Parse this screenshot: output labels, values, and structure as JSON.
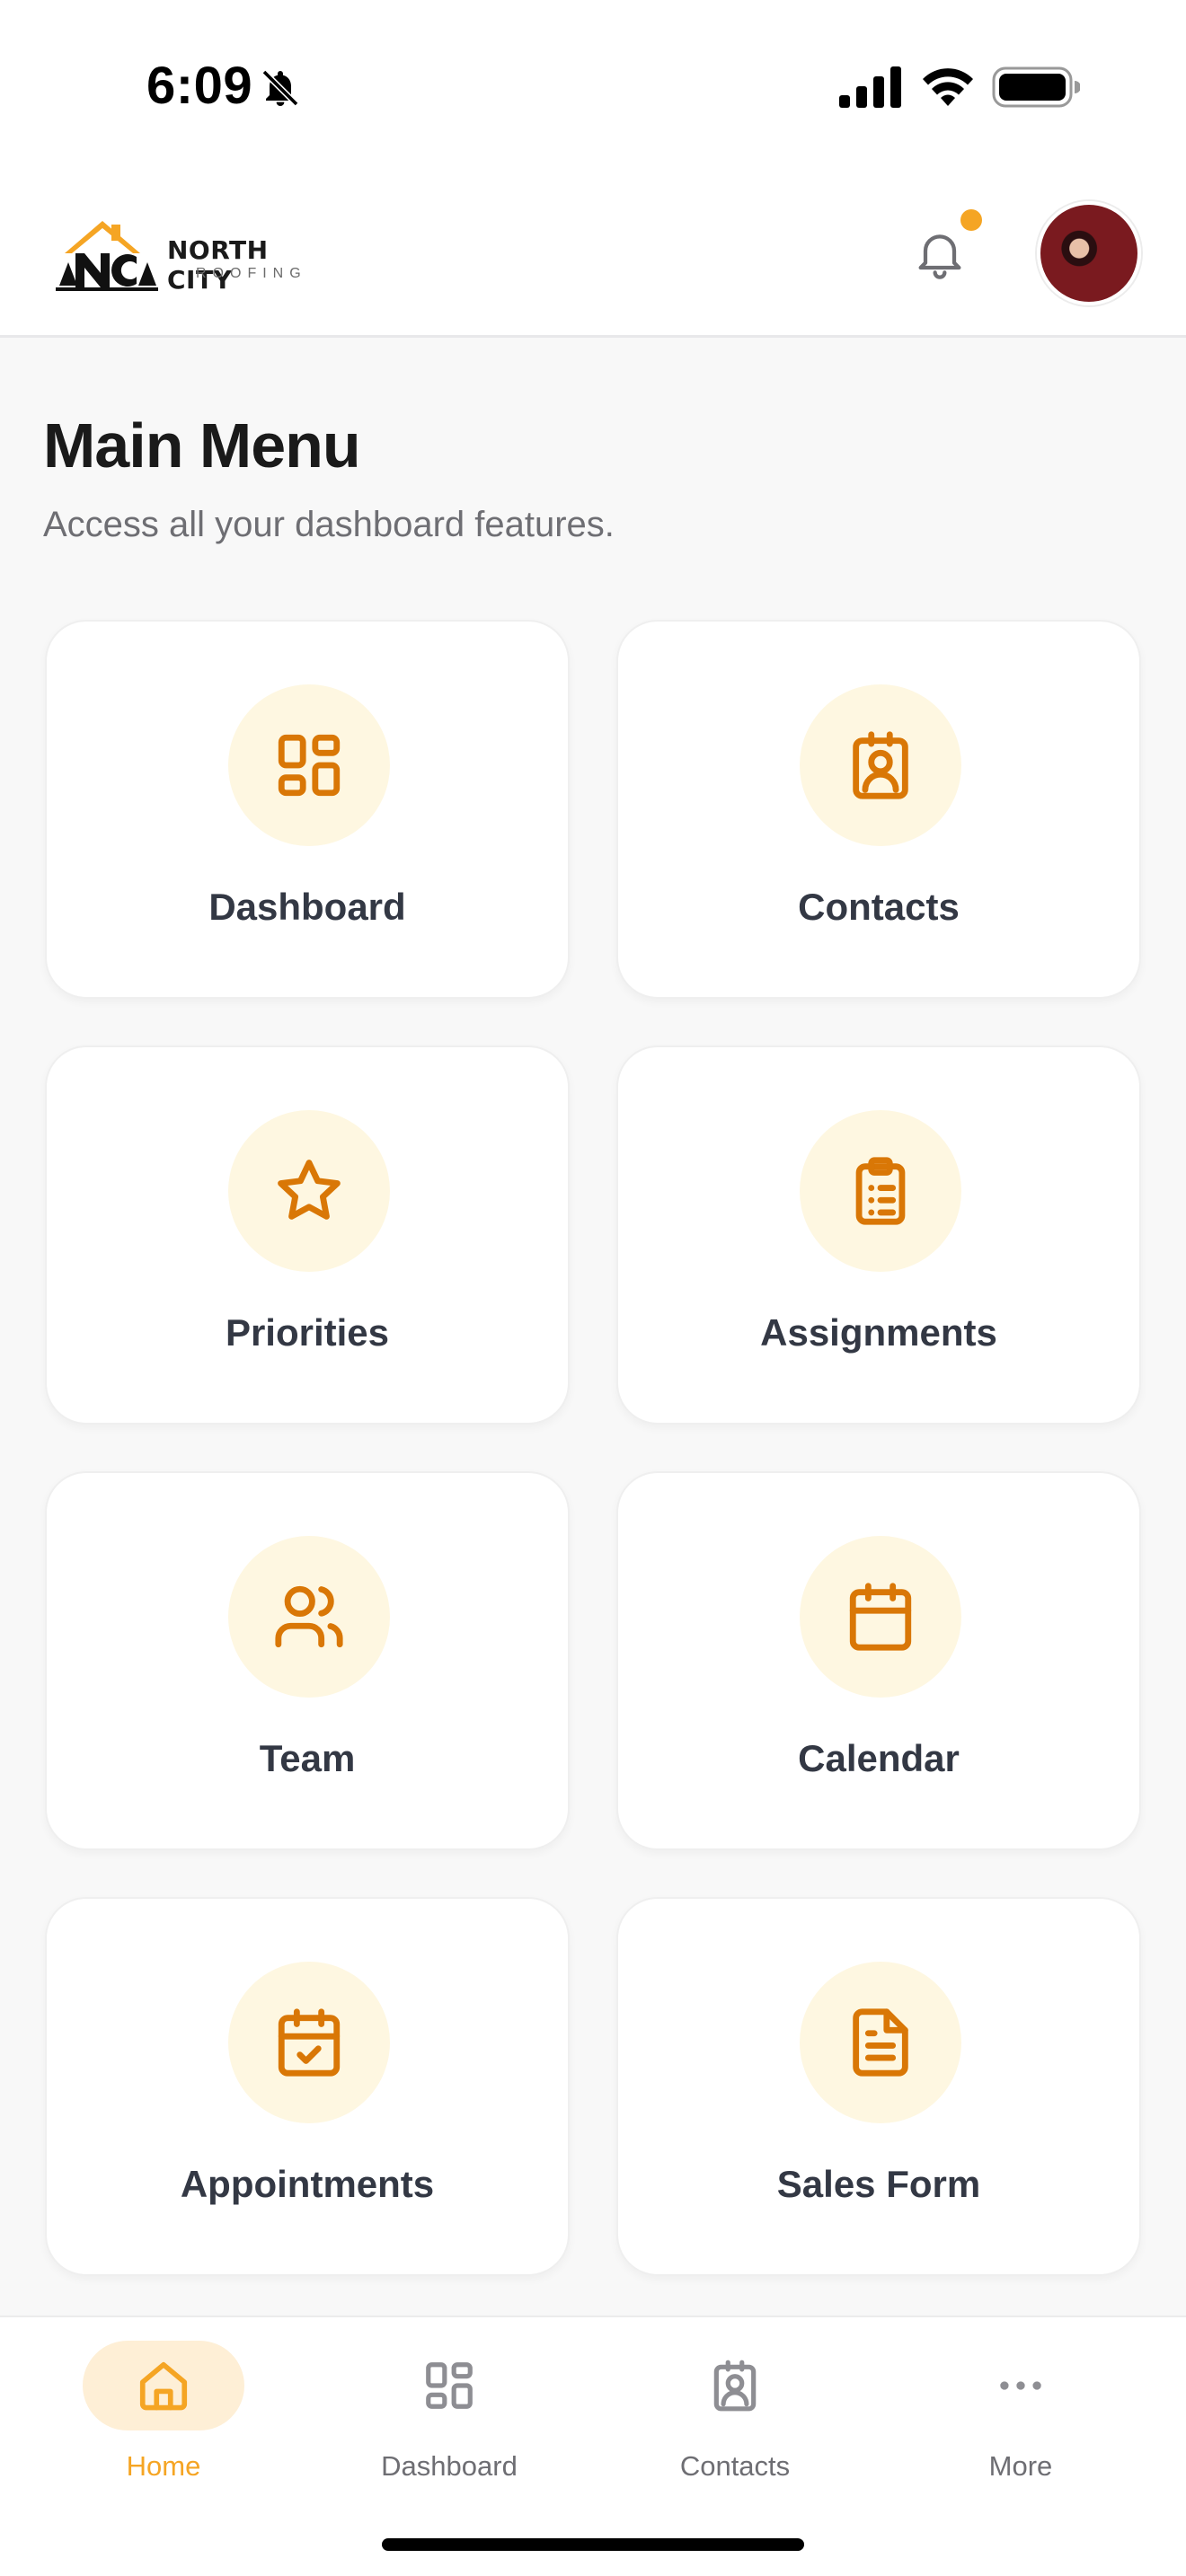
{
  "status_bar": {
    "time": "6:09",
    "icons": [
      "bell-slash-icon",
      "cellular-signal-icon",
      "wifi-icon",
      "battery-icon"
    ]
  },
  "header": {
    "logo_title": "NORTH CITY",
    "logo_subtitle": "ROOFING",
    "notification_dot": true,
    "icons": [
      "bell-icon",
      "avatar"
    ]
  },
  "main": {
    "title": "Main Menu",
    "subtitle": "Access all your dashboard features.",
    "menu_items": [
      {
        "label": "Dashboard",
        "icon": "dashboard-grid-icon"
      },
      {
        "label": "Contacts",
        "icon": "contact-card-icon"
      },
      {
        "label": "Priorities",
        "icon": "star-icon"
      },
      {
        "label": "Assignments",
        "icon": "clipboard-list-icon"
      },
      {
        "label": "Team",
        "icon": "users-icon"
      },
      {
        "label": "Calendar",
        "icon": "calendar-icon"
      },
      {
        "label": "Appointments",
        "icon": "calendar-check-icon"
      },
      {
        "label": "Sales Form",
        "icon": "document-icon"
      }
    ]
  },
  "bottom_nav": {
    "items": [
      {
        "label": "Home",
        "icon": "home-icon",
        "active": true
      },
      {
        "label": "Dashboard",
        "icon": "dashboard-grid-icon",
        "active": false
      },
      {
        "label": "Contacts",
        "icon": "contact-card-icon",
        "active": false
      },
      {
        "label": "More",
        "icon": "more-dots-icon",
        "active": false
      }
    ]
  },
  "colors": {
    "accent": "#f5a524",
    "icon_orange": "#d97706",
    "icon_bg": "#fef7e1",
    "active_tab_bg": "#feefd6",
    "inactive_gray": "#6e6e73"
  }
}
